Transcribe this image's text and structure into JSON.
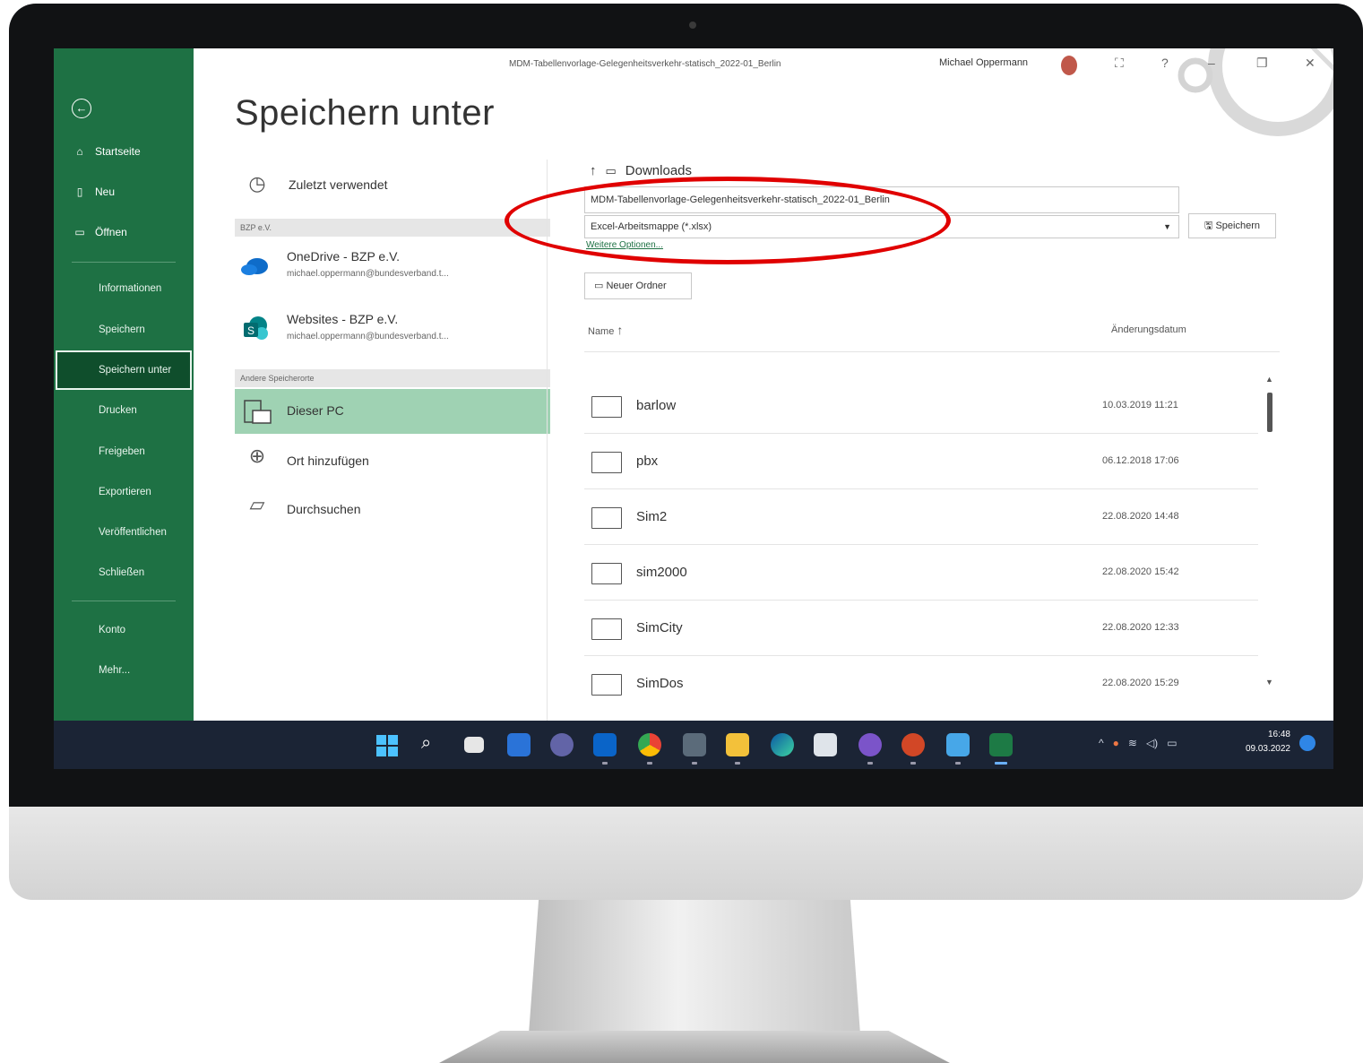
{
  "window": {
    "document_title": "MDM-Tabellenvorlage-Gelegenheitsverkehr-statisch_2022-01_Berlin",
    "user_name": "Michael Oppermann"
  },
  "sidebar": {
    "top_items": [
      "Startseite",
      "Neu",
      "Öffnen"
    ],
    "items": [
      "Informationen",
      "Speichern",
      "Speichern unter",
      "Drucken",
      "Freigeben",
      "Exportieren",
      "Veröffentlichen",
      "Schließen"
    ],
    "bottom_items": [
      "Konto",
      "Mehr..."
    ],
    "active_item": "Speichern unter"
  },
  "page_title": "Speichern unter",
  "locations": {
    "recent": "Zuletzt verwendet",
    "org_header": "BZP e.V.",
    "onedrive": {
      "name": "OneDrive - BZP e.V.",
      "account": "michael.oppermann@bundesverband.t..."
    },
    "websites": {
      "name": "Websites - BZP e.V.",
      "account": "michael.oppermann@bundesverband.t..."
    },
    "other_header": "Andere Speicherorte",
    "this_pc": "Dieser PC",
    "add_place": "Ort hinzufügen",
    "browse": "Durchsuchen"
  },
  "save_panel": {
    "current_folder": "Downloads",
    "filename": "MDM-Tabellenvorlage-Gelegenheitsverkehr-statisch_2022-01_Berlin",
    "file_type": "Excel-Arbeitsmappe (*.xlsx)",
    "save_button": "Speichern",
    "more_options": "Weitere Optionen...",
    "new_folder_button": "Neuer Ordner",
    "col_name": "Name",
    "col_date": "Änderungsdatum"
  },
  "files": [
    {
      "name": "barlow",
      "date": "10.03.2019 11:21"
    },
    {
      "name": "pbx",
      "date": "06.12.2018 17:06"
    },
    {
      "name": "Sim2",
      "date": "22.08.2020 14:48"
    },
    {
      "name": "sim2000",
      "date": "22.08.2020 15:42"
    },
    {
      "name": "SimCity",
      "date": "22.08.2020 12:33"
    },
    {
      "name": "SimDos",
      "date": "22.08.2020 15:29"
    }
  ],
  "taskbar": {
    "time": "16:48",
    "date": "09.03.2022",
    "apps": [
      "windows-start",
      "search",
      "task-view",
      "widgets",
      "teams",
      "outlook",
      "chrome",
      "vpn",
      "file-explorer",
      "edge",
      "notepad",
      "teams-purple",
      "powerpoint",
      "notes",
      "excel"
    ]
  },
  "colors": {
    "excel_green": "#1e7144",
    "selected_location": "#9fd2b3",
    "callout_red": "#e00000",
    "taskbar": "#1b2435"
  }
}
